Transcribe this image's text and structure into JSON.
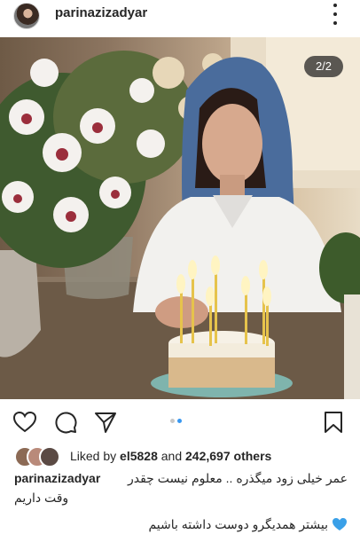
{
  "post": {
    "username": "parinazizadyar",
    "page_counter": "2/2",
    "carousel": {
      "total": 2,
      "active_index": 1
    }
  },
  "likes": {
    "prefix": "Liked by",
    "liker": "el5828",
    "conjunction": "and",
    "count_text": "242,697 others"
  },
  "caption": {
    "username": "parinazizadyar",
    "line1": "عمر خیلی زود میگذره .. معلوم نیست چقدر",
    "line2": "وقت داریم",
    "line3": "بیشتر همدیگرو دوست داشته باشیم"
  },
  "icons": {
    "header": [
      "avatar",
      "more-options-icon"
    ],
    "actions": [
      "heart-icon",
      "comment-icon",
      "share-icon",
      "bookmark-icon"
    ],
    "caption_emoji": "blue-heart-icon"
  },
  "colors": {
    "accent_blue": "#3897f0",
    "text": "#262626",
    "heart_blue": "#3aa0e8"
  }
}
